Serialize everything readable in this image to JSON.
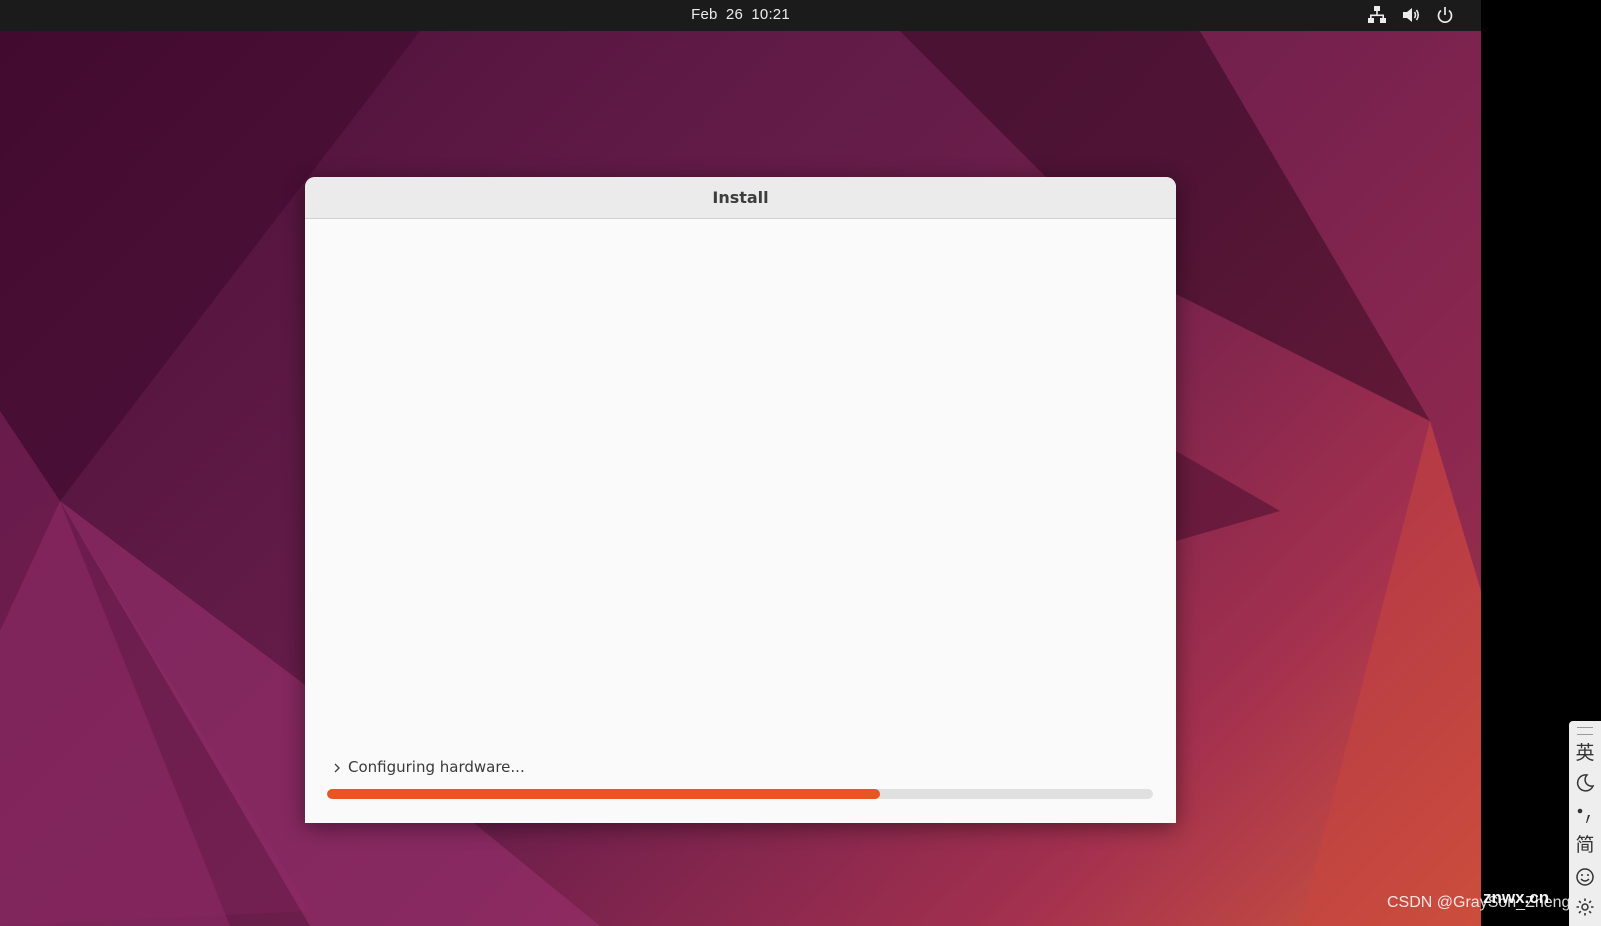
{
  "topbar": {
    "clock": "Feb 26  10:21",
    "tray_icons": [
      "network-icon",
      "volume-icon",
      "power-icon"
    ]
  },
  "window": {
    "title": "Install",
    "status_text": "Configuring hardware...",
    "progress_fraction": 0.67
  },
  "ime_toolbar": {
    "items": [
      "英",
      "简"
    ],
    "icons": [
      "moon-icon",
      "punctuation-icon",
      "emoji-icon",
      "gear-icon"
    ]
  },
  "watermarks": {
    "csdn": "CSDN @GraySon_Zheng",
    "site": "znwx.cn"
  },
  "colors": {
    "accent": "#e95420",
    "topbar": "#1b1b1b",
    "window_bg": "#fafafa",
    "titlebar_bg": "#ebebeb"
  }
}
